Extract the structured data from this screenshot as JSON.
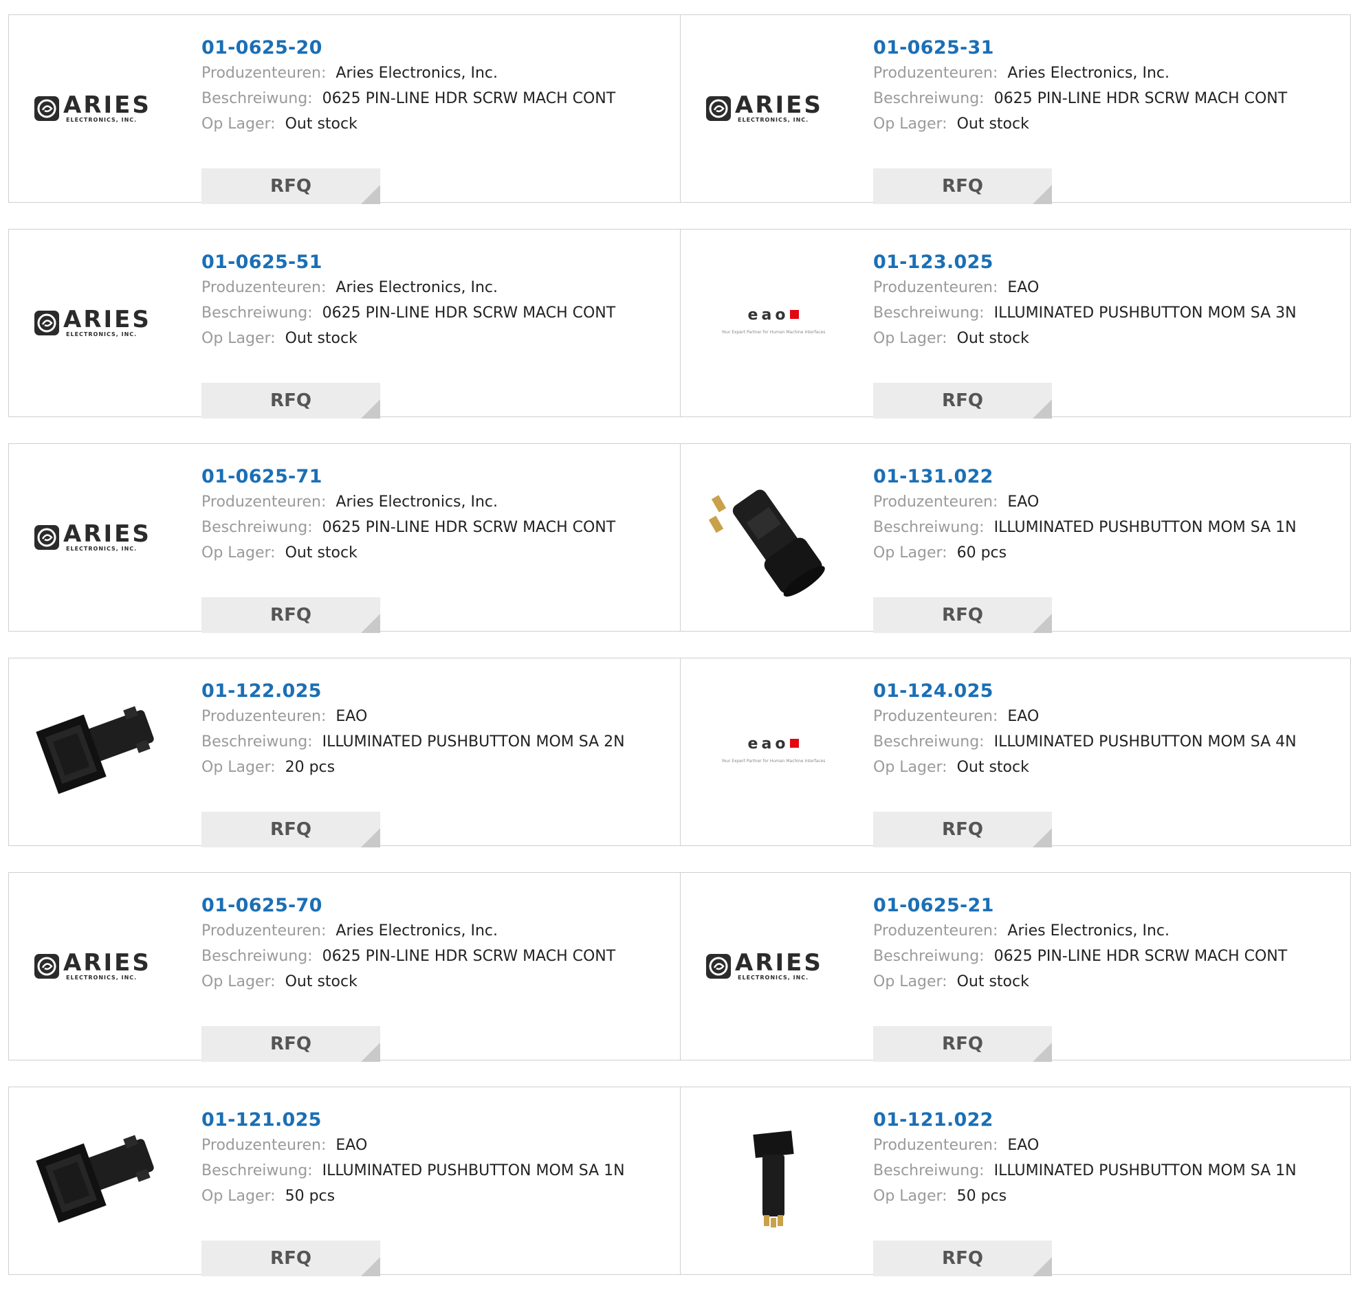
{
  "labels": {
    "manufacturer": "Produzenteuren:",
    "description": "Beschreiwung:",
    "stock": "Op Lager:",
    "rfq": "RFQ"
  },
  "logos": {
    "aries_name": "ARIES",
    "aries_sub": "ELECTRONICS, INC.",
    "eao_name": "eao",
    "eao_tagline": "Your Expert Partner for Human Machine Interfaces"
  },
  "colors": {
    "part_link": "#1b6fb5",
    "label_gray": "#9a9a9a",
    "rfq_bg": "#ececec",
    "eao_red": "#e30613"
  },
  "products": [
    {
      "part": "01-0625-20",
      "manufacturer": "Aries Electronics, Inc.",
      "description": "0625 PIN-LINE HDR SCRW MACH CONT",
      "stock": "Out stock",
      "image": "aries-logo"
    },
    {
      "part": "01-0625-31",
      "manufacturer": "Aries Electronics, Inc.",
      "description": "0625 PIN-LINE HDR SCRW MACH CONT",
      "stock": "Out stock",
      "image": "aries-logo"
    },
    {
      "part": "01-0625-51",
      "manufacturer": "Aries Electronics, Inc.",
      "description": "0625 PIN-LINE HDR SCRW MACH CONT",
      "stock": "Out stock",
      "image": "aries-logo"
    },
    {
      "part": "01-123.025",
      "manufacturer": "EAO",
      "description": "ILLUMINATED PUSHBUTTON MOM SA 3N",
      "stock": "Out stock",
      "image": "eao-logo"
    },
    {
      "part": "01-0625-71",
      "manufacturer": "Aries Electronics, Inc.",
      "description": "0625 PIN-LINE HDR SCRW MACH CONT",
      "stock": "Out stock",
      "image": "aries-logo"
    },
    {
      "part": "01-131.022",
      "manufacturer": "EAO",
      "description": "ILLUMINATED PUSHBUTTON MOM SA 1N",
      "stock": "60 pcs",
      "image": "round-pushbutton"
    },
    {
      "part": "01-122.025",
      "manufacturer": "EAO",
      "description": "ILLUMINATED PUSHBUTTON MOM SA 2N",
      "stock": "20 pcs",
      "image": "square-pushbutton"
    },
    {
      "part": "01-124.025",
      "manufacturer": "EAO",
      "description": "ILLUMINATED PUSHBUTTON MOM SA 4N",
      "stock": "Out stock",
      "image": "eao-logo"
    },
    {
      "part": "01-0625-70",
      "manufacturer": "Aries Electronics, Inc.",
      "description": "0625 PIN-LINE HDR SCRW MACH CONT",
      "stock": "Out stock",
      "image": "aries-logo"
    },
    {
      "part": "01-0625-21",
      "manufacturer": "Aries Electronics, Inc.",
      "description": "0625 PIN-LINE HDR SCRW MACH CONT",
      "stock": "Out stock",
      "image": "aries-logo"
    },
    {
      "part": "01-121.025",
      "manufacturer": "EAO",
      "description": "ILLUMINATED PUSHBUTTON MOM SA 1N",
      "stock": "50 pcs",
      "image": "square-pushbutton"
    },
    {
      "part": "01-121.022",
      "manufacturer": "EAO",
      "description": "ILLUMINATED PUSHBUTTON MOM SA 1N",
      "stock": "50 pcs",
      "image": "small-square-pushbutton"
    }
  ]
}
